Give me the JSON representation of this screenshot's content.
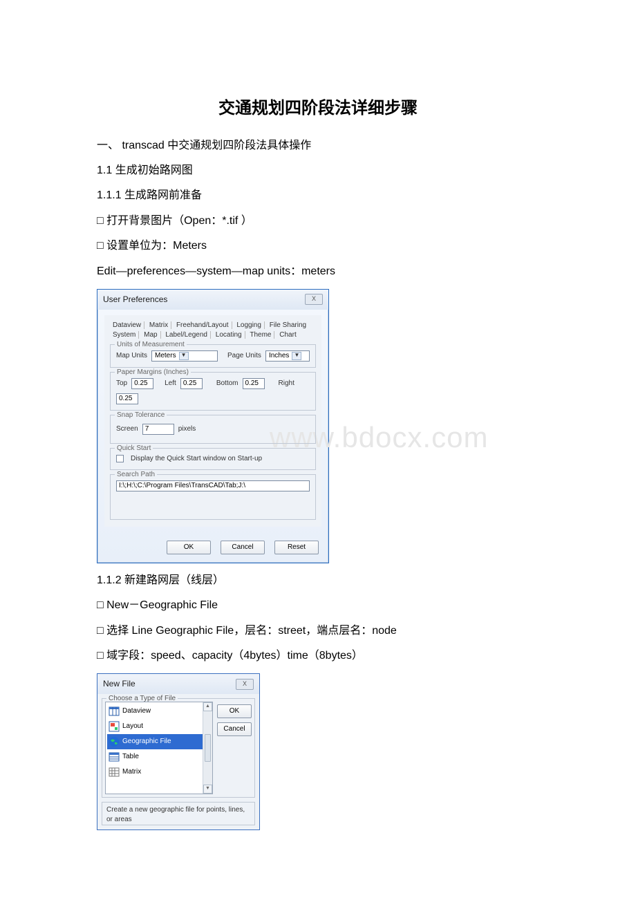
{
  "title": "交通规划四阶段法详细步骤",
  "paras": {
    "p1": "一、 transcad 中交通规划四阶段法具体操作",
    "p2": "1.1 生成初始路网图",
    "p3": "1.1.1 生成路网前准备",
    "p4": "□ 打开背景图片（Open：*.tif ）",
    "p5": "□ 设置单位为：Meters",
    "p6": "Edit—preferences—system—map units：meters",
    "p7": "1.1.2 新建路网层（线层）",
    "p8": "□ New－Geographic File",
    "p9": "□ 选择 Line Geographic File，层名：street，端点层名：node",
    "p10": "□ 域字段：speed、capacity（4bytes）time（8bytes）"
  },
  "dialog1": {
    "title": "User Preferences",
    "close": "X",
    "tabs_row1": [
      "Dataview",
      "Matrix",
      "Freehand/Layout",
      "Logging",
      "File Sharing"
    ],
    "tabs_row2": [
      "System",
      "Map",
      "Label/Legend",
      "Locating",
      "Theme",
      "Chart"
    ],
    "group_units": {
      "legend": "Units of Measurement",
      "map_units_lbl": "Map Units",
      "map_units_val": "Meters",
      "page_units_lbl": "Page Units",
      "page_units_val": "Inches"
    },
    "group_margins": {
      "legend": "Paper Margins (Inches)",
      "top_lbl": "Top",
      "top_val": "0.25",
      "left_lbl": "Left",
      "left_val": "0.25",
      "bottom_lbl": "Bottom",
      "bottom_val": "0.25",
      "right_lbl": "Right",
      "right_val": "0.25"
    },
    "group_snap": {
      "legend": "Snap Tolerance",
      "screen_lbl": "Screen",
      "screen_val": "7",
      "pixels_lbl": "pixels"
    },
    "group_quick": {
      "legend": "Quick Start",
      "chk_lbl": "Display the Quick Start window on Start-up"
    },
    "group_search": {
      "legend": "Search Path",
      "val": "I:\\;H:\\;C:\\Program Files\\TransCAD\\Tab;J:\\"
    },
    "buttons": {
      "ok": "OK",
      "cancel": "Cancel",
      "reset": "Reset"
    }
  },
  "watermark": "www.bdocx.com",
  "dialog2": {
    "title": "New File",
    "close": "X",
    "group_legend": "Choose a Type of File",
    "items": {
      "i0": "Dataview",
      "i1": "Layout",
      "i2": "Geographic File",
      "i3": "Table",
      "i4": "Matrix"
    },
    "buttons": {
      "ok": "OK",
      "cancel": "Cancel"
    },
    "desc": "Create a new geographic file for points, lines, or areas"
  }
}
